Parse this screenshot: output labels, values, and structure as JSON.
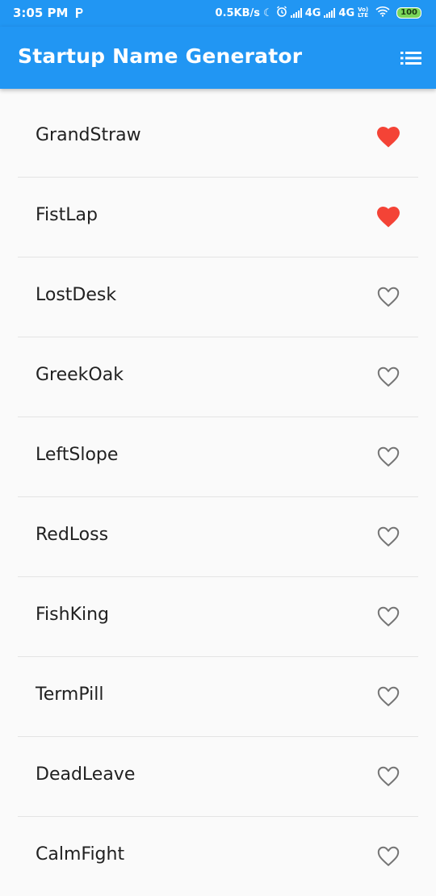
{
  "status_bar": {
    "time": "3:05 PM",
    "carrier_icon": "p-icon",
    "speed": "0.5KB/s",
    "net1": "4G",
    "net2": "4G",
    "volte": "Vo) LTE",
    "battery": "100"
  },
  "app_bar": {
    "title": "Startup Name Generator",
    "action_icon": "list-icon"
  },
  "colors": {
    "primary": "#2196f3",
    "favorite": "#f44336",
    "unfavorite": "#757575"
  },
  "names": [
    {
      "label": "GrandStraw",
      "saved": true
    },
    {
      "label": "FistLap",
      "saved": true
    },
    {
      "label": "LostDesk",
      "saved": false
    },
    {
      "label": "GreekOak",
      "saved": false
    },
    {
      "label": "LeftSlope",
      "saved": false
    },
    {
      "label": "RedLoss",
      "saved": false
    },
    {
      "label": "FishKing",
      "saved": false
    },
    {
      "label": "TermPill",
      "saved": false
    },
    {
      "label": "DeadLeave",
      "saved": false
    },
    {
      "label": "CalmFight",
      "saved": false
    }
  ]
}
